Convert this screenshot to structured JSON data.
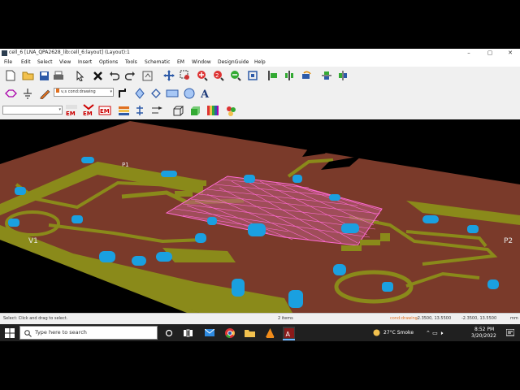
{
  "window": {
    "title": "cell_6 [LNA_QPA2628_lib:cell_6:layout] (Layout):1",
    "controls": {
      "minimize": "–",
      "maximize": "▢",
      "close": "✕"
    }
  },
  "menu": [
    "File",
    "Edit",
    "Select",
    "View",
    "Insert",
    "Options",
    "Tools",
    "Schematic",
    "EM",
    "Window",
    "DesignGuide",
    "Help"
  ],
  "toolbar": {
    "layer_combo": "v,s cond:drawing",
    "layer_color": "#e07020",
    "second_combo": ""
  },
  "canvas_labels": {
    "port_left": "V1",
    "port_left_top": "P1",
    "port_right": "P2"
  },
  "status": {
    "hint": "Select: Click and drag to select.",
    "items": "2 items",
    "layer": "cond:drawing",
    "coord1": "-2.3500, 13.5500",
    "coord2": "-2.3500, 13.5500",
    "unit": "mm"
  },
  "taskbar": {
    "search_placeholder": "Type here to search",
    "weather": "27°C  Smoke",
    "time": "8:52 PM",
    "date": "3/20/2022"
  },
  "colors": {
    "substrate": "#7a3a2a",
    "conductor": "#8a8a1a",
    "via": "#1aa0e0",
    "mesh": "#ff6ad5",
    "canvas_bg": "#000000"
  }
}
